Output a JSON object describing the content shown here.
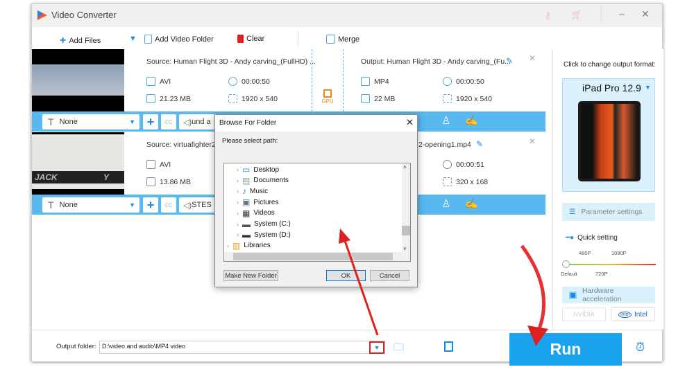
{
  "app": {
    "title": "Video Converter"
  },
  "toolbar": {
    "add_files": "Add Files",
    "add_video_folder": "Add Video Folder",
    "clear": "Clear",
    "merge": "Merge"
  },
  "items": [
    {
      "source": "Source: Human Flight 3D - Andy carving_(FullHD) ...",
      "src_format": "AVI",
      "src_duration": "00:00:50",
      "src_size": "21.23 MB",
      "src_res": "1920 x 540",
      "gpu": "GPU",
      "output": "Output: Human Flight 3D - Andy carving_(Fu...",
      "out_format": "MP4",
      "out_duration": "00:00:50",
      "out_size": "22 MB",
      "out_res": "1920 x 540",
      "subtitle": "None",
      "audio": "und a"
    },
    {
      "source": "Source: virtuafighter2-o",
      "src_format": "AVI",
      "src_size": "13.86 MB",
      "output": "2-opening1.mp4",
      "out_duration": "00:00:51",
      "out_res": "320 x 168",
      "subtitle": "None",
      "audio": "STES",
      "thumb_text1": "JACK",
      "thumb_text2": "Y"
    }
  ],
  "right": {
    "hint": "Click to change output format:",
    "format": "iPad Pro 12.9",
    "parameter_settings": "Parameter settings",
    "quick_setting": "Quick setting",
    "q_labels_top": [
      "480P",
      "1080P"
    ],
    "q_labels_bottom": [
      "Default",
      "720P"
    ],
    "quality_level": 0,
    "hardware_acceleration": "Hardware acceleration",
    "nvidia": "NVIDIA",
    "intel": "Intel"
  },
  "bottom": {
    "output_folder_label": "Output folder:",
    "output_folder_value": "D:\\video and audio\\MP4 video",
    "run": "Run"
  },
  "dialog": {
    "title": "Browse For Folder",
    "prompt": "Please select path:",
    "nodes": [
      "Desktop",
      "Documents",
      "Music",
      "Pictures",
      "Videos",
      "System (C:)",
      "System (D:)",
      "Libraries"
    ],
    "make_new_folder": "Make New Folder",
    "ok": "OK",
    "cancel": "Cancel"
  },
  "colors": {
    "accent": "#1aa3ef",
    "bar": "#58b8f0",
    "arrow": "#e02020"
  }
}
